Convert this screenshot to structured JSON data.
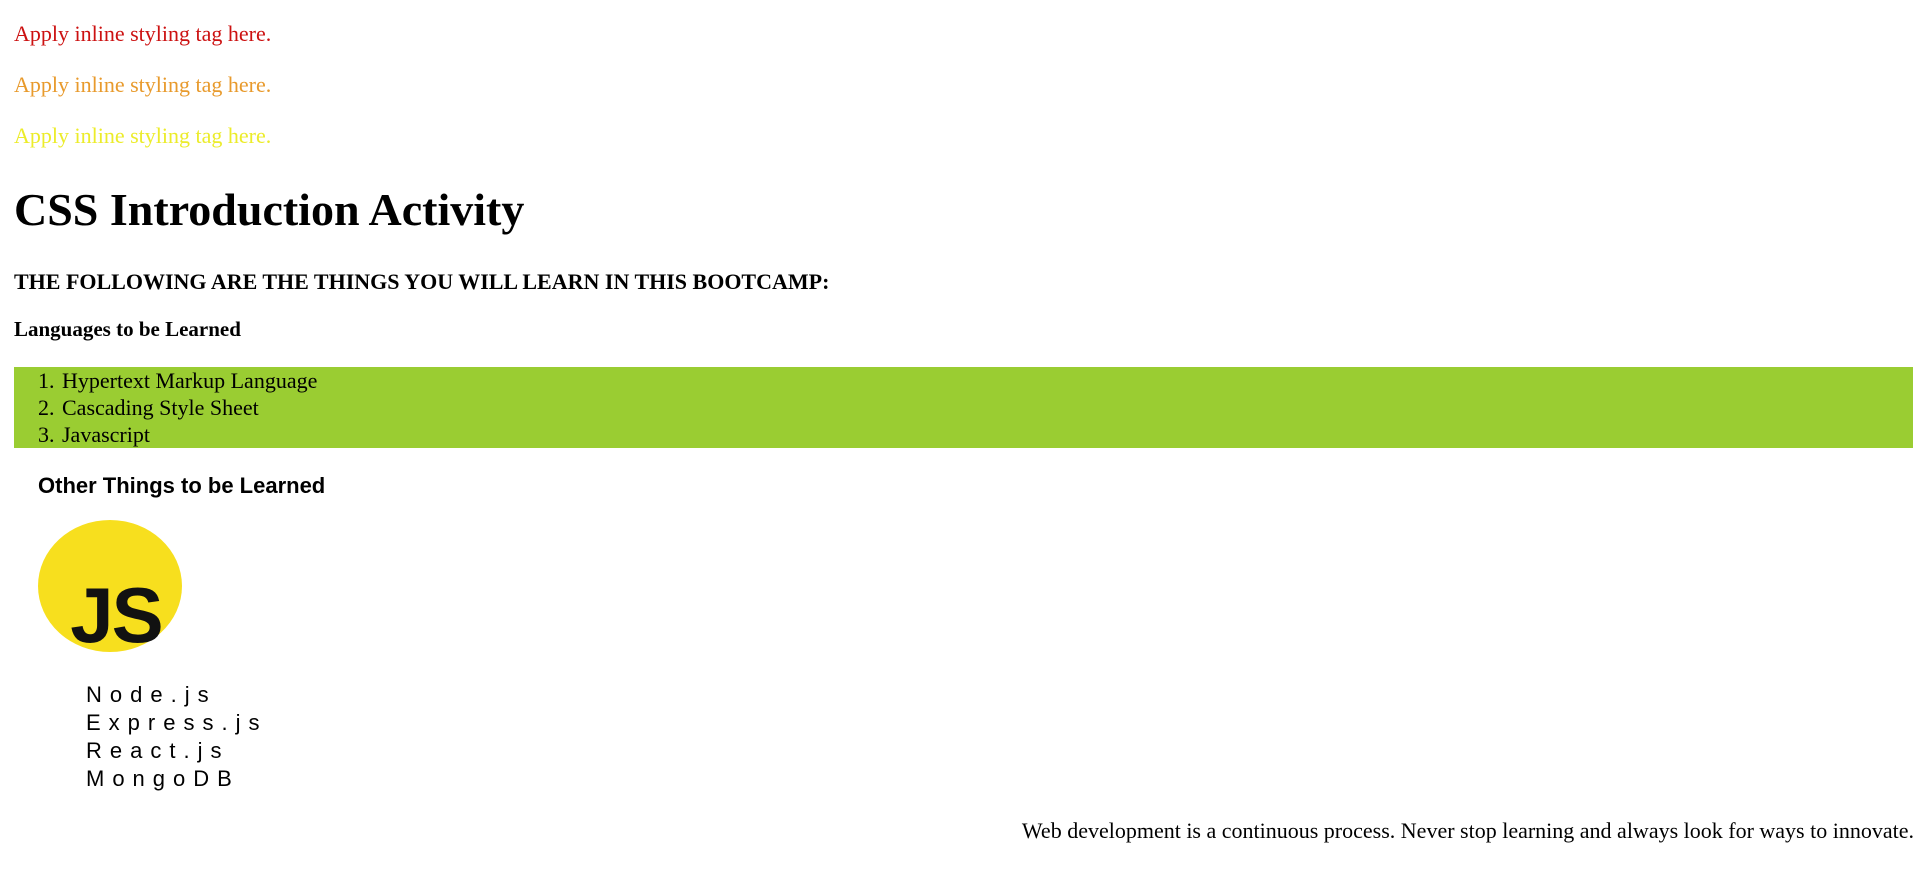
{
  "inline_paragraphs": [
    {
      "text": "Apply inline styling tag here.",
      "color": "#cc1111"
    },
    {
      "text": "Apply inline styling tag here.",
      "color": "#e89a2c"
    },
    {
      "text": "Apply inline styling tag here.",
      "color": "#ecec2a"
    }
  ],
  "title": "CSS Introduction Activity",
  "subtitle": "THE FOLLOWING ARE THE THINGS YOU WILL LEARN IN THIS BOOTCAMP:",
  "languages": {
    "heading": "Languages to be Learned",
    "background": "#9acd32",
    "items": [
      {
        "num": "1.",
        "label": "Hypertext Markup Language"
      },
      {
        "num": "2.",
        "label": "Cascading Style Sheet"
      },
      {
        "num": "3.",
        "label": "Javascript"
      }
    ]
  },
  "other": {
    "heading": "Other Things to be Learned",
    "logo": {
      "icon": "javascript-logo-icon",
      "text": "JS",
      "color": "#f7df1e"
    },
    "items": [
      "Node.js",
      "Express.js",
      "React.js",
      "MongoDB"
    ]
  },
  "footer": {
    "text": "Web development is a continuous process. Never stop learning and always look for ways to innovate."
  }
}
